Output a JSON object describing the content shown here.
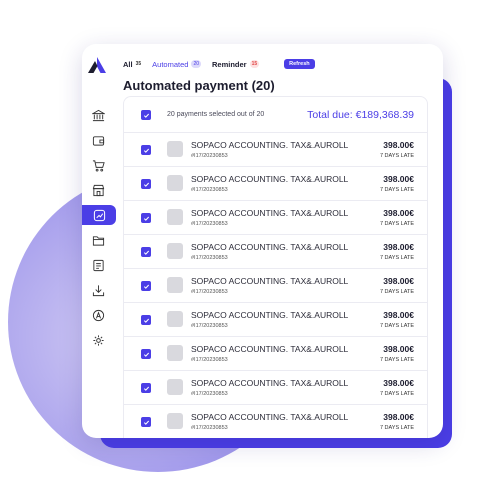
{
  "colors": {
    "accent": "#4b3ee6",
    "blob": "#a49cec",
    "placeholder": "#d9d9de"
  },
  "sidebar": {
    "logo": "a-logo",
    "icons": [
      {
        "name": "bank-icon",
        "active": false
      },
      {
        "name": "wallet-icon",
        "active": false
      },
      {
        "name": "cart-icon",
        "active": false
      },
      {
        "name": "store-icon",
        "active": false
      },
      {
        "name": "chart-icon",
        "active": true
      },
      {
        "name": "folder-icon",
        "active": false
      },
      {
        "name": "document-icon",
        "active": false
      },
      {
        "name": "download-icon",
        "active": false
      },
      {
        "name": "a-badge-icon",
        "active": false
      },
      {
        "name": "gear-icon",
        "active": false
      }
    ]
  },
  "tabs": {
    "all_label": "All",
    "all_count": "35",
    "automated_label": "Automated",
    "automated_count": "20",
    "reminder_label": "Reminder",
    "reminder_count": "15",
    "refresh_label": "Refresh"
  },
  "page_title": "Automated payment (20)",
  "summary": {
    "selected_text": "20 payments selected out of 20",
    "total_due": "Total due: €189,368.39"
  },
  "payments": [
    {
      "name": "SOPACO ACCOUNTING. TAX&.AUROLL",
      "ref": "#I17/20230853",
      "amount": "398.00€",
      "status": "7 DAYS LATE"
    },
    {
      "name": "SOPACO ACCOUNTING. TAX&.AUROLL",
      "ref": "#I17/20230853",
      "amount": "398.00€",
      "status": "7 DAYS LATE"
    },
    {
      "name": "SOPACO ACCOUNTING. TAX&.AUROLL",
      "ref": "#I17/20230853",
      "amount": "398.00€",
      "status": "7 DAYS LATE"
    },
    {
      "name": "SOPACO ACCOUNTING. TAX&.AUROLL",
      "ref": "#I17/20230853",
      "amount": "398.00€",
      "status": "7 DAYS LATE"
    },
    {
      "name": "SOPACO ACCOUNTING. TAX&.AUROLL",
      "ref": "#I17/20230853",
      "amount": "398.00€",
      "status": "7 DAYS LATE"
    },
    {
      "name": "SOPACO ACCOUNTING. TAX&.AUROLL",
      "ref": "#I17/20230853",
      "amount": "398.00€",
      "status": "7 DAYS LATE"
    },
    {
      "name": "SOPACO ACCOUNTING. TAX&.AUROLL",
      "ref": "#I17/20230853",
      "amount": "398.00€",
      "status": "7 DAYS LATE"
    },
    {
      "name": "SOPACO ACCOUNTING. TAX&.AUROLL",
      "ref": "#I17/20230853",
      "amount": "398.00€",
      "status": "7 DAYS LATE"
    },
    {
      "name": "SOPACO ACCOUNTING. TAX&.AUROLL",
      "ref": "#I17/20230853",
      "amount": "398.00€",
      "status": "7 DAYS LATE"
    }
  ]
}
